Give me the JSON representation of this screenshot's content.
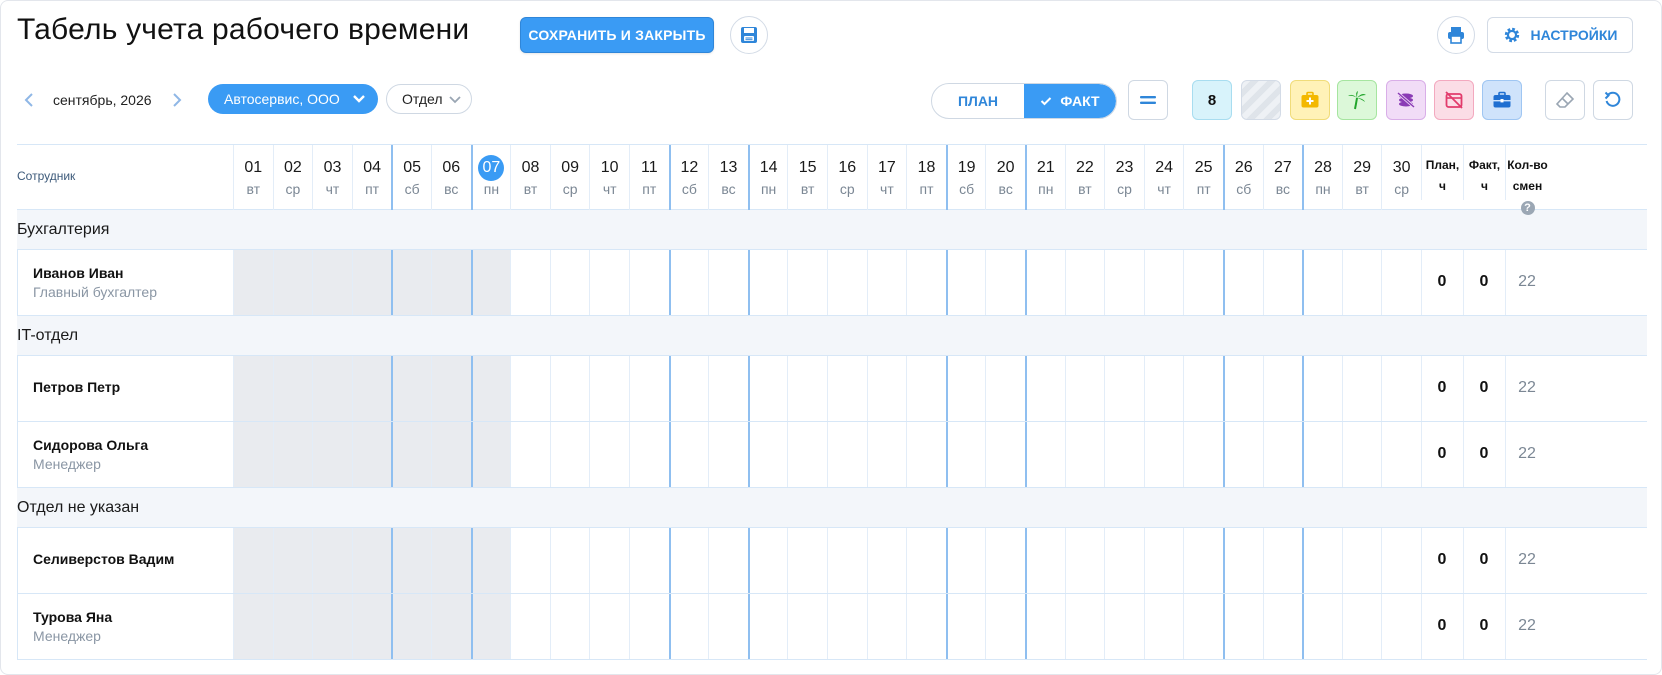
{
  "header": {
    "title": "Табель учета рабочего времени",
    "save_close_label": "СОХРАНИТЬ И ЗАКРЫТЬ",
    "settings_label": "НАСТРОЙКИ"
  },
  "filters": {
    "month": "сентябрь, 2026",
    "organization": "Автосервис, ООО",
    "department": "Отдел"
  },
  "mode_toggle": {
    "plan_label": "ПЛАН",
    "fact_label": "ФАКТ",
    "selected": "ФАКТ"
  },
  "tools": {
    "hours_label": "8"
  },
  "colors": {
    "accent": "#3a9bf4",
    "weekend_cell": "#e9ebef",
    "sick": "#f3b800",
    "vacation": "#21a52b",
    "unpaid": "#8a3bb5",
    "absent": "#e23b6c",
    "trip": "#1f6fd1"
  },
  "table": {
    "employee_header": "Сотрудник",
    "plan_header_1": "План,",
    "plan_header_2": "ч",
    "fact_header_1": "Факт,",
    "fact_header_2": "ч",
    "shifts_header_1": "Кол-во",
    "shifts_header_2": "смен",
    "shifts_help": "?",
    "today": "07",
    "days": [
      {
        "d": "01",
        "w": "вт"
      },
      {
        "d": "02",
        "w": "ср"
      },
      {
        "d": "03",
        "w": "чт"
      },
      {
        "d": "04",
        "w": "пт"
      },
      {
        "d": "05",
        "w": "сб"
      },
      {
        "d": "06",
        "w": "вс"
      },
      {
        "d": "07",
        "w": "пн"
      },
      {
        "d": "08",
        "w": "вт"
      },
      {
        "d": "09",
        "w": "ср"
      },
      {
        "d": "10",
        "w": "чт"
      },
      {
        "d": "11",
        "w": "пт"
      },
      {
        "d": "12",
        "w": "сб"
      },
      {
        "d": "13",
        "w": "вс"
      },
      {
        "d": "14",
        "w": "пн"
      },
      {
        "d": "15",
        "w": "вт"
      },
      {
        "d": "16",
        "w": "ср"
      },
      {
        "d": "17",
        "w": "чт"
      },
      {
        "d": "18",
        "w": "пт"
      },
      {
        "d": "19",
        "w": "сб"
      },
      {
        "d": "20",
        "w": "вс"
      },
      {
        "d": "21",
        "w": "пн"
      },
      {
        "d": "22",
        "w": "вт"
      },
      {
        "d": "23",
        "w": "ср"
      },
      {
        "d": "24",
        "w": "чт"
      },
      {
        "d": "25",
        "w": "пт"
      },
      {
        "d": "26",
        "w": "сб"
      },
      {
        "d": "27",
        "w": "вс"
      },
      {
        "d": "28",
        "w": "пн"
      },
      {
        "d": "29",
        "w": "вт"
      },
      {
        "d": "30",
        "w": "ср"
      }
    ],
    "groups": [
      {
        "name": "Бухгалтерия",
        "employees": [
          {
            "name": "Иванов Иван",
            "position": "Главный бухгалтер",
            "plan": "0",
            "fact": "0",
            "shifts": "22"
          }
        ]
      },
      {
        "name": "IT-отдел",
        "employees": [
          {
            "name": "Петров Петр",
            "position": "",
            "plan": "0",
            "fact": "0",
            "shifts": "22"
          },
          {
            "name": "Сидорова Ольга",
            "position": "Менеджер",
            "plan": "0",
            "fact": "0",
            "shifts": "22"
          }
        ]
      },
      {
        "name": "Отдел не указан",
        "employees": [
          {
            "name": "Селиверстов Вадим",
            "position": "",
            "plan": "0",
            "fact": "0",
            "shifts": "22"
          },
          {
            "name": "Турова Яна",
            "position": "Менеджер",
            "plan": "0",
            "fact": "0",
            "shifts": "22"
          }
        ]
      }
    ]
  }
}
